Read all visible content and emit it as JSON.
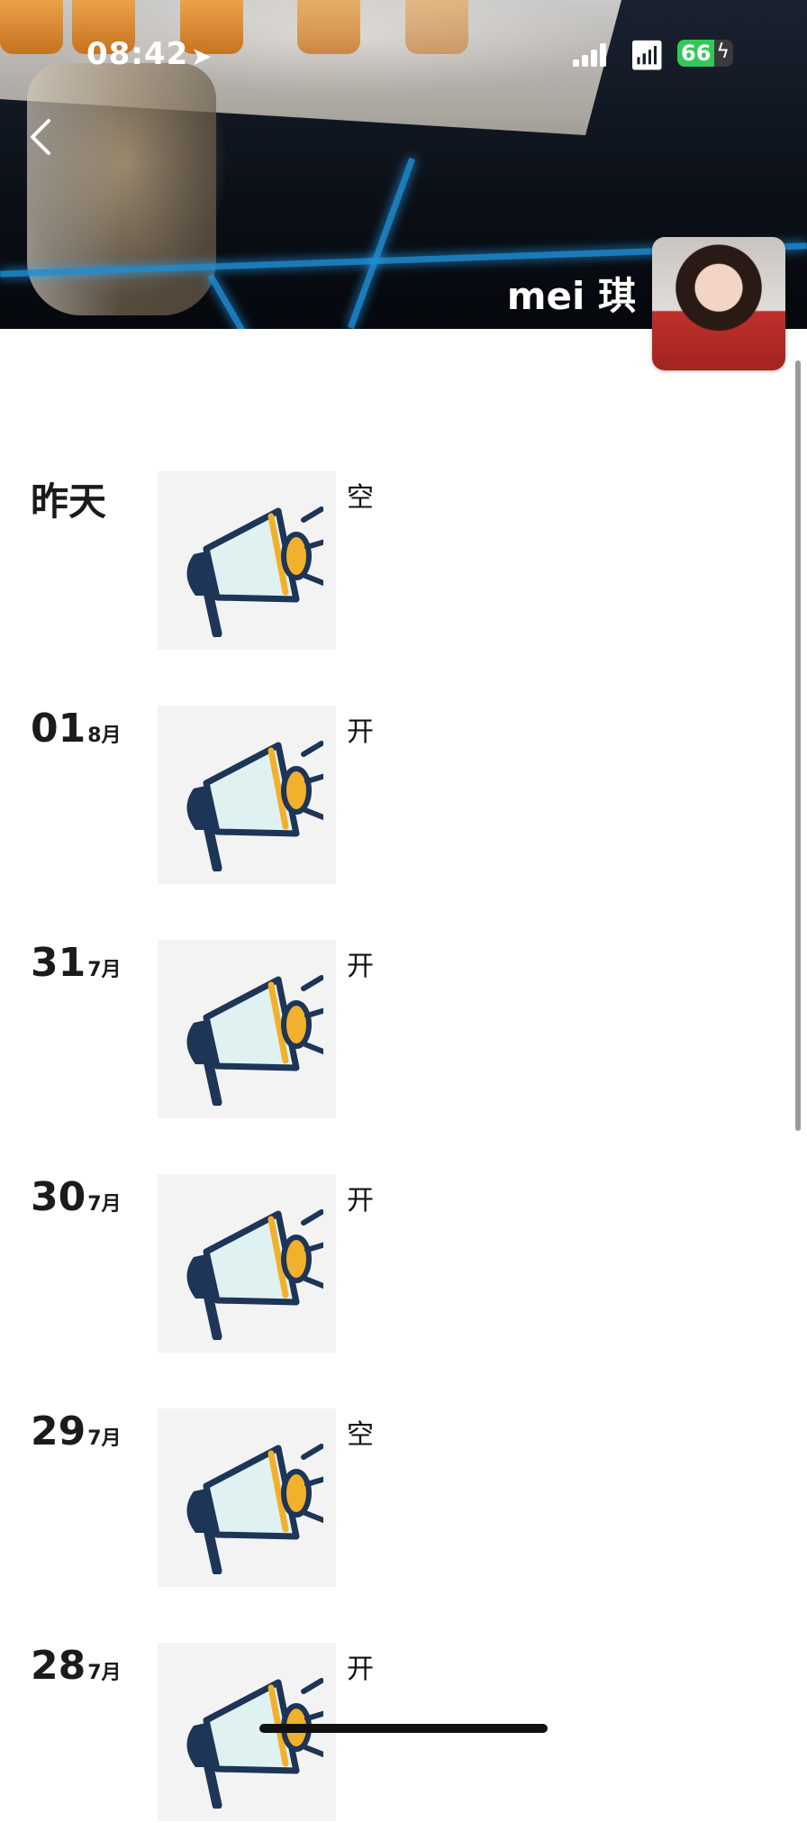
{
  "status_bar": {
    "time": "08:42",
    "battery": "66",
    "battery_percent": 66
  },
  "profile": {
    "name": "mei 琪"
  },
  "posts": [
    {
      "day": "昨天",
      "month": "",
      "caption": "空",
      "image": "megaphone-icon"
    },
    {
      "day": "01",
      "month": "8月",
      "caption": "开",
      "image": "megaphone-icon"
    },
    {
      "day": "31",
      "month": "7月",
      "caption": "开",
      "image": "megaphone-icon"
    },
    {
      "day": "30",
      "month": "7月",
      "caption": "开",
      "image": "megaphone-icon"
    },
    {
      "day": "29",
      "month": "7月",
      "caption": "空",
      "image": "megaphone-icon"
    },
    {
      "day": "28",
      "month": "7月",
      "caption": "开",
      "image": "megaphone-icon"
    }
  ]
}
